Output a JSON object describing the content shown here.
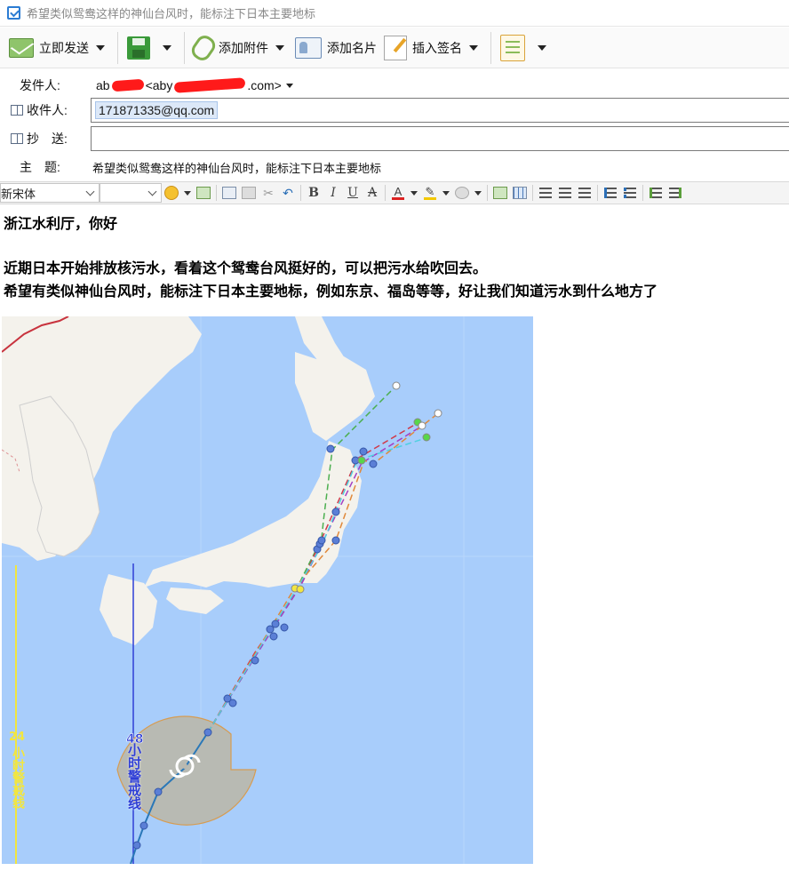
{
  "window": {
    "title": "希望类似鸳鸯这样的神仙台风时，能标注下日本主要地标"
  },
  "toolbar": {
    "send_label": "立即发送",
    "attach_label": "添加附件",
    "card_label": "添加名片",
    "sign_label": "插入签名"
  },
  "header": {
    "from_label": "发件人:",
    "from_prefix": "ab",
    "from_mid": "<aby",
    "from_suffix": ".com>",
    "to_label": "收件人:",
    "to_value": "171871335@qq.com",
    "cc_label": "抄　送:",
    "cc_value": "",
    "subject_label": "主　题:",
    "subject_value": "希望类似鸳鸯这样的神仙台风时，能标注下日本主要地标"
  },
  "format": {
    "font_name": "新宋体",
    "font_size": "",
    "bold": "B",
    "italic": "I",
    "underline": "U",
    "strike": "A",
    "font_color_glyph": "A"
  },
  "body": {
    "greeting": "浙江水利厅，你好",
    "line1": "近期日本开始排放核污水，看着这个鸳鸯台风挺好的，可以把污水给吹回去。",
    "line2": "希望有类似神仙台风时，能标注下日本主要地标，例如东京、福岛等等，好让我们知道污水到什么地方了"
  },
  "map": {
    "label_48": "48",
    "label_48_text": "小时警戒线",
    "label_24": "24",
    "label_24_text": "小时警戒线",
    "colors": {
      "sea": "#a8cdfb",
      "land": "#f4f2ec",
      "border": "#c8333e",
      "line48": "#2f3fd6",
      "line24": "#f2e640",
      "track": "#2a78b8"
    }
  }
}
